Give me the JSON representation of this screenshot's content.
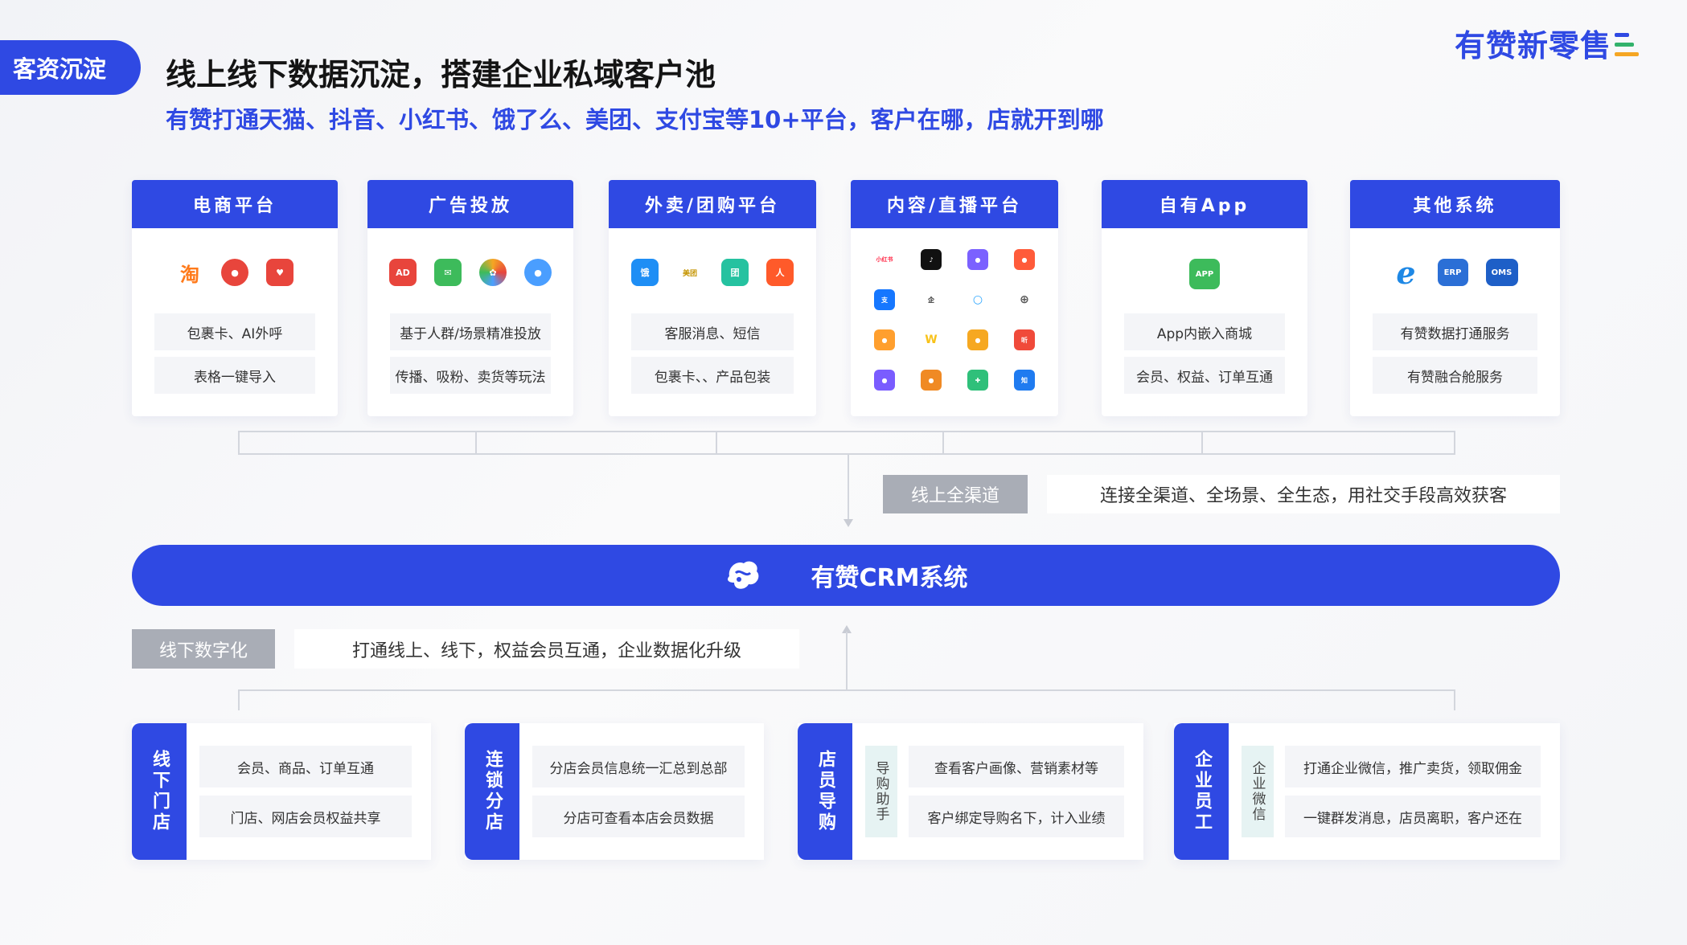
{
  "header": {
    "tag": "客资沉淀",
    "title": "线上线下数据沉淀，搭建企业私域客户池",
    "subtitle": "有赞打通天猫、抖音、小红书、饿了么、美团、支付宝等10+平台，客户在哪，店就开到哪",
    "logo": "有赞新零售"
  },
  "platforms": [
    {
      "name": "电商平台",
      "icons": [
        {
          "label": "淘",
          "color": "#ff7a1a"
        },
        {
          "label": "●",
          "color": "#e8453c"
        },
        {
          "label": "♥",
          "color": "#e8453c"
        }
      ],
      "items": [
        "包裹卡、AI外呼",
        "表格一键导入"
      ]
    },
    {
      "name": "广告投放",
      "icons": [
        {
          "label": "AD",
          "color": "#e8453c"
        },
        {
          "label": "✉",
          "color": "#3dbb5b"
        },
        {
          "label": "✿",
          "color": "#f5a623"
        },
        {
          "label": "●",
          "color": "#4a9eff"
        }
      ],
      "items": [
        "基于人群/场景精准投放",
        "传播、吸粉、卖货等玩法"
      ]
    },
    {
      "name": "外卖/团购平台",
      "icons": [
        {
          "label": "饿",
          "color": "#1e8ef5"
        },
        {
          "label": "美团",
          "color": "#f7c61a"
        },
        {
          "label": "团",
          "color": "#25c2a0"
        },
        {
          "label": "人",
          "color": "#ff5a2a"
        }
      ],
      "items": [
        "客服消息、短信",
        "包裹卡、、产品包装"
      ]
    },
    {
      "name": "内容/直播平台",
      "grid": [
        {
          "label": "小红书",
          "color": "#ff2442"
        },
        {
          "label": "♪",
          "color": "#111111"
        },
        {
          "label": "●",
          "color": "#7b61ff"
        },
        {
          "label": "●",
          "color": "#ff5b3a"
        },
        {
          "label": "支",
          "color": "#1677ff"
        },
        {
          "label": "企",
          "color": "#222222"
        },
        {
          "label": "○",
          "color": "#2da6ff"
        },
        {
          "label": "⊕",
          "color": "#555555"
        },
        {
          "label": "●",
          "color": "#ff9f2e"
        },
        {
          "label": "W",
          "color": "#f8c21a"
        },
        {
          "label": "●",
          "color": "#f6a821"
        },
        {
          "label": "听",
          "color": "#f04a3a"
        },
        {
          "label": "●",
          "color": "#7a5cff"
        },
        {
          "label": "●",
          "color": "#f08a24"
        },
        {
          "label": "✚",
          "color": "#2fc07a"
        },
        {
          "label": "知",
          "color": "#1f7bf0"
        }
      ]
    },
    {
      "name": "自有App",
      "icons": [
        {
          "label": "APP",
          "color": "#3dbb5b"
        }
      ],
      "items": [
        "App内嵌入商城",
        "会员、权益、订单互通"
      ]
    },
    {
      "name": "其他系统",
      "icons": [
        {
          "label": "e",
          "color": "#1e88e5"
        },
        {
          "label": "ERP",
          "color": "#2b6fd6"
        },
        {
          "label": "OMS",
          "color": "#1e5fc7"
        }
      ],
      "items": [
        "有赞数据打通服务",
        "有赞融合舱服务"
      ]
    }
  ],
  "online": {
    "tag": "线上全渠道",
    "desc": "连接全渠道、全场景、全生态，用社交手段高效获客"
  },
  "crm": {
    "label": "有赞CRM系统"
  },
  "offline": {
    "tag": "线下数字化",
    "desc": "打通线上、线下，权益会员互通，企业数据化升级"
  },
  "stores": [
    {
      "name": "线下门店",
      "items": [
        "会员、商品、订单互通",
        "门店、网店会员权益共享"
      ]
    },
    {
      "name": "连锁分店",
      "items": [
        "分店会员信息统一汇总到总部",
        "分店可查看本店会员数据"
      ]
    },
    {
      "name": "店员导购",
      "sub": "导购助手",
      "items": [
        "查看客户画像、营销素材等",
        "客户绑定导购名下，计入业绩"
      ]
    },
    {
      "name": "企业员工",
      "sub": "企业微信",
      "items": [
        "打通企业微信，推广卖货，领取佣金",
        "一键群发消息，店员离职，客户还在"
      ]
    }
  ]
}
